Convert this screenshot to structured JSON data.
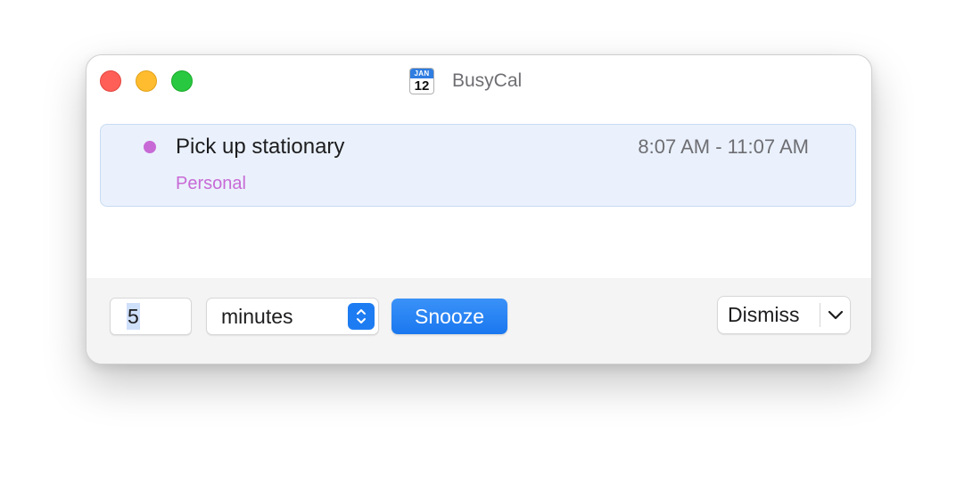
{
  "window": {
    "title": "BusyCal",
    "app_icon": {
      "name": "calendar-icon",
      "month": "JAN",
      "day": "12"
    }
  },
  "event": {
    "title": "Pick up stationary",
    "time": "8:07 AM - 11:07 AM",
    "calendar": "Personal",
    "calendar_color": "#c86ad6"
  },
  "footer": {
    "snooze_amount": "5",
    "snooze_unit": "minutes",
    "snooze_label": "Snooze",
    "dismiss_label": "Dismiss"
  },
  "colors": {
    "accent": "#1a77ef",
    "selection": "#eaf1fc"
  }
}
